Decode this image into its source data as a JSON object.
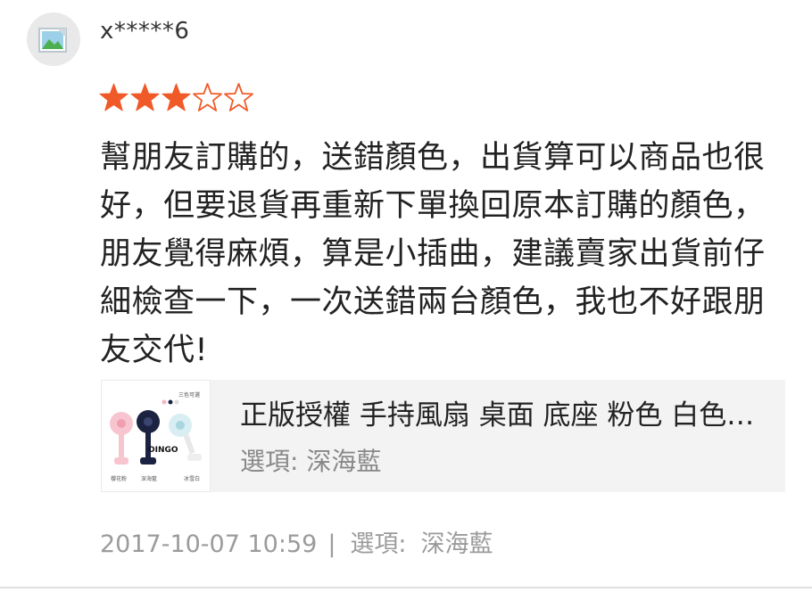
{
  "review": {
    "username": "x*****6",
    "rating": 3,
    "max_rating": 5,
    "star_color": "#f05a28",
    "text": "幫朋友訂購的，送錯顏色，出貨算可以商品也很好，但要退貨再重新下單換回原本訂購的顏色，朋友覺得麻煩，算是小插曲，建議賣家出貨前仔細檢查一下，一次送錯兩台顏色，我也不好跟朋友交代!",
    "product": {
      "name": "正版授權 手持風扇 桌面 底座 粉色 白色 深海藍",
      "option": "選項: 深海藍",
      "thumbnail": {
        "brand_text": "OINGO",
        "caption_top": "三色可選",
        "labels": [
          "櫻花粉",
          "深海藍",
          "冰雪白"
        ]
      }
    },
    "meta": {
      "timestamp": "2017-10-07 10:59",
      "separator": "|",
      "option_label": "選項:",
      "option_value": "深海藍"
    }
  }
}
